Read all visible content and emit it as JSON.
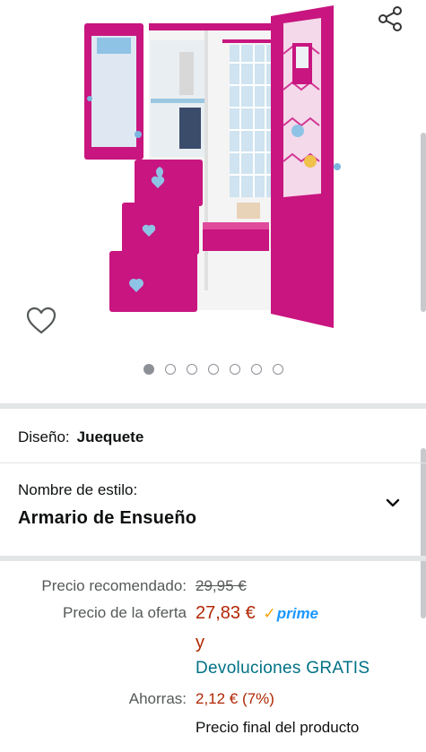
{
  "gallery": {
    "image_alt": "Armario de juguete rosa",
    "dot_count": 7,
    "active_dot": 0
  },
  "icons": {
    "share": "share-icon",
    "wishlist": "heart-outline-icon",
    "chevron": "chevron-down-icon"
  },
  "design": {
    "label": "Diseño:",
    "value": "Juequete"
  },
  "style": {
    "label": "Nombre de estilo:",
    "value": "Armario de Ensueño"
  },
  "pricing": {
    "recommended_label": "Precio recomendado:",
    "recommended_value": "29,95 €",
    "offer_label": "Precio de la oferta",
    "offer_value": "27,83 €",
    "prime_label": "prime",
    "and_text": "y",
    "returns_text": "Devoluciones GRATIS",
    "savings_label": "Ahorras:",
    "savings_value": "2,12 € (7%)",
    "final_text": "Precio final del producto"
  },
  "colors": {
    "price_red": "#b12704",
    "link_teal": "#007185",
    "prime_blue": "#1a98ff",
    "wardrobe_pink": "#c8157f"
  }
}
